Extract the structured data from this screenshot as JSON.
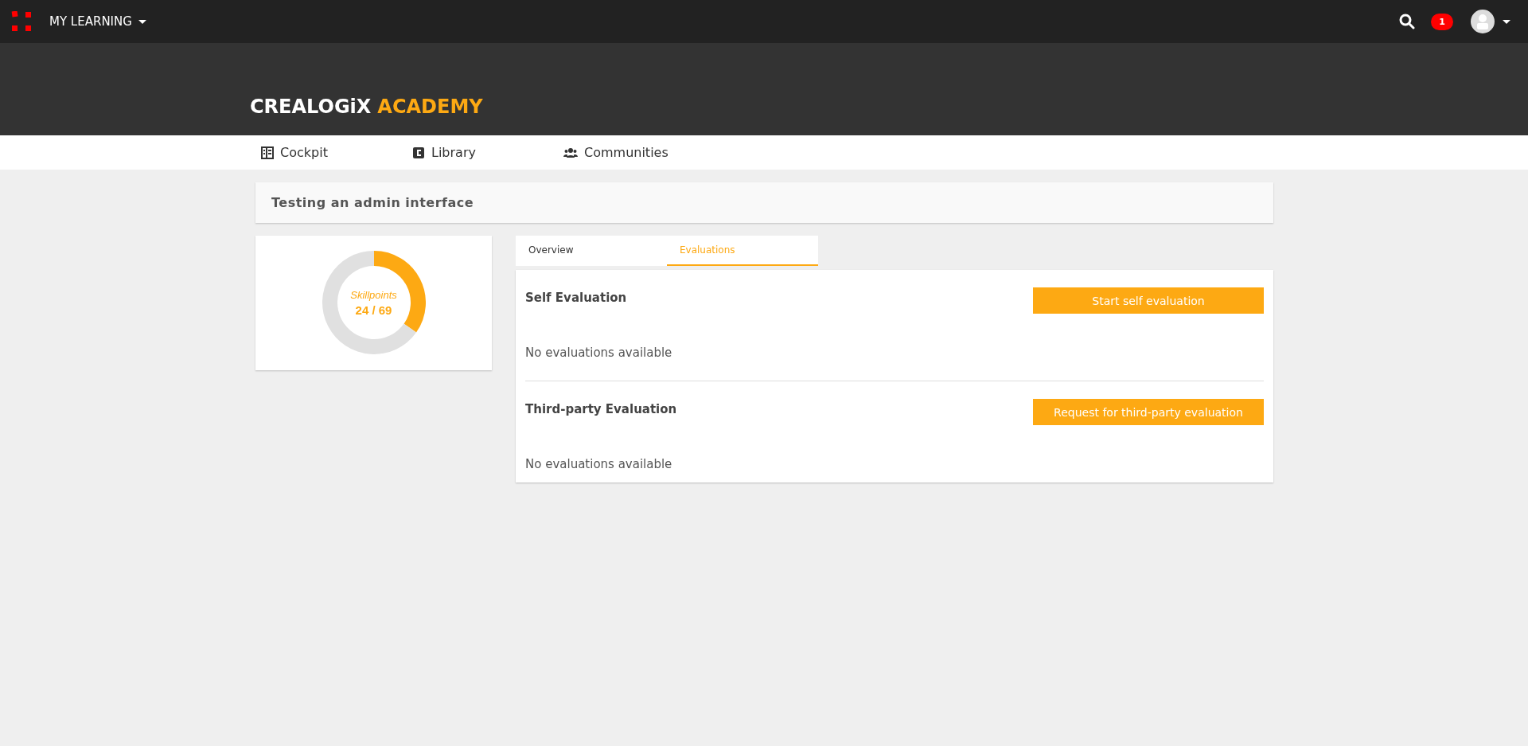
{
  "topbar": {
    "menu_label": "MY LEARNING",
    "notification_count": "1"
  },
  "logo": {
    "brand": "CREALOGiX",
    "product": "ACADEMY"
  },
  "nav": [
    {
      "kind": "cockpit",
      "label": "Cockpit"
    },
    {
      "kind": "library",
      "label": "Library"
    },
    {
      "kind": "communities",
      "label": "Communities"
    }
  ],
  "course": {
    "title": "Testing an admin interface"
  },
  "skillpoints": {
    "label": "Skillpoints",
    "reading": "24 / 69",
    "chart_data": {
      "type": "donut",
      "values": [
        34.8,
        65.2
      ]
    }
  },
  "tabs": [
    {
      "label": "Overview",
      "selected": false
    },
    {
      "label": "Evaluations",
      "selected": true
    }
  ],
  "sections": [
    {
      "title": "Self Evaluation",
      "button": "Start self evaluation",
      "empty_text": "No evaluations available"
    },
    {
      "title": "Third-party Evaluation",
      "button": "Request for third-party evaluation",
      "empty_text": "No evaluations available"
    }
  ]
}
